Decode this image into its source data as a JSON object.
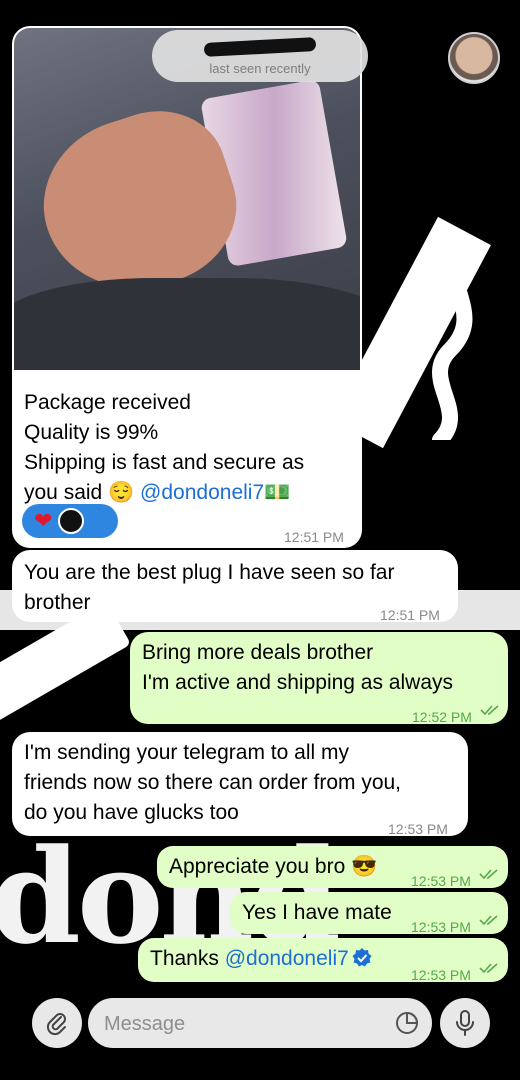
{
  "header": {
    "status": "last seen recently",
    "back_icon": "chevron-left-icon",
    "avatar_icon": "avatar"
  },
  "messages": [
    {
      "direction": "in",
      "type": "photo",
      "lines": [
        "Package received",
        "Quality is 99%",
        "Shipping is fast and secure as",
        "you said 😌 "
      ],
      "mention": "@dondoneli7",
      "mention_suffix": "💵",
      "reactions": [
        "❤"
      ],
      "time": "12:51 PM"
    },
    {
      "direction": "in",
      "lines": [
        "You are the best plug I have seen so far",
        "brother"
      ],
      "time": "12:51 PM"
    },
    {
      "direction": "out",
      "lines": [
        "Bring more deals brother",
        "I'm active and shipping as always"
      ],
      "time": "12:52 PM"
    },
    {
      "direction": "in",
      "lines": [
        "I'm sending your telegram to all my",
        "friends now so there can order from you,",
        "do you have glucks too"
      ],
      "time": "12:53 PM"
    },
    {
      "direction": "out",
      "lines": [
        "Appreciate you bro 😎"
      ],
      "time": "12:53 PM"
    },
    {
      "direction": "out",
      "lines": [
        "Yes I have mate"
      ],
      "time": "12:53 PM"
    },
    {
      "direction": "out",
      "text": "Thanks ",
      "mention": "@dondoneli7",
      "time": "12:53 PM"
    }
  ],
  "composer": {
    "placeholder": "Message"
  },
  "colors": {
    "incoming": "#ffffff",
    "outgoing": "#e1fec6",
    "link": "#1b6fd6",
    "outgoing_time": "#57a84a",
    "reaction_pill": "#2f86e0"
  }
}
